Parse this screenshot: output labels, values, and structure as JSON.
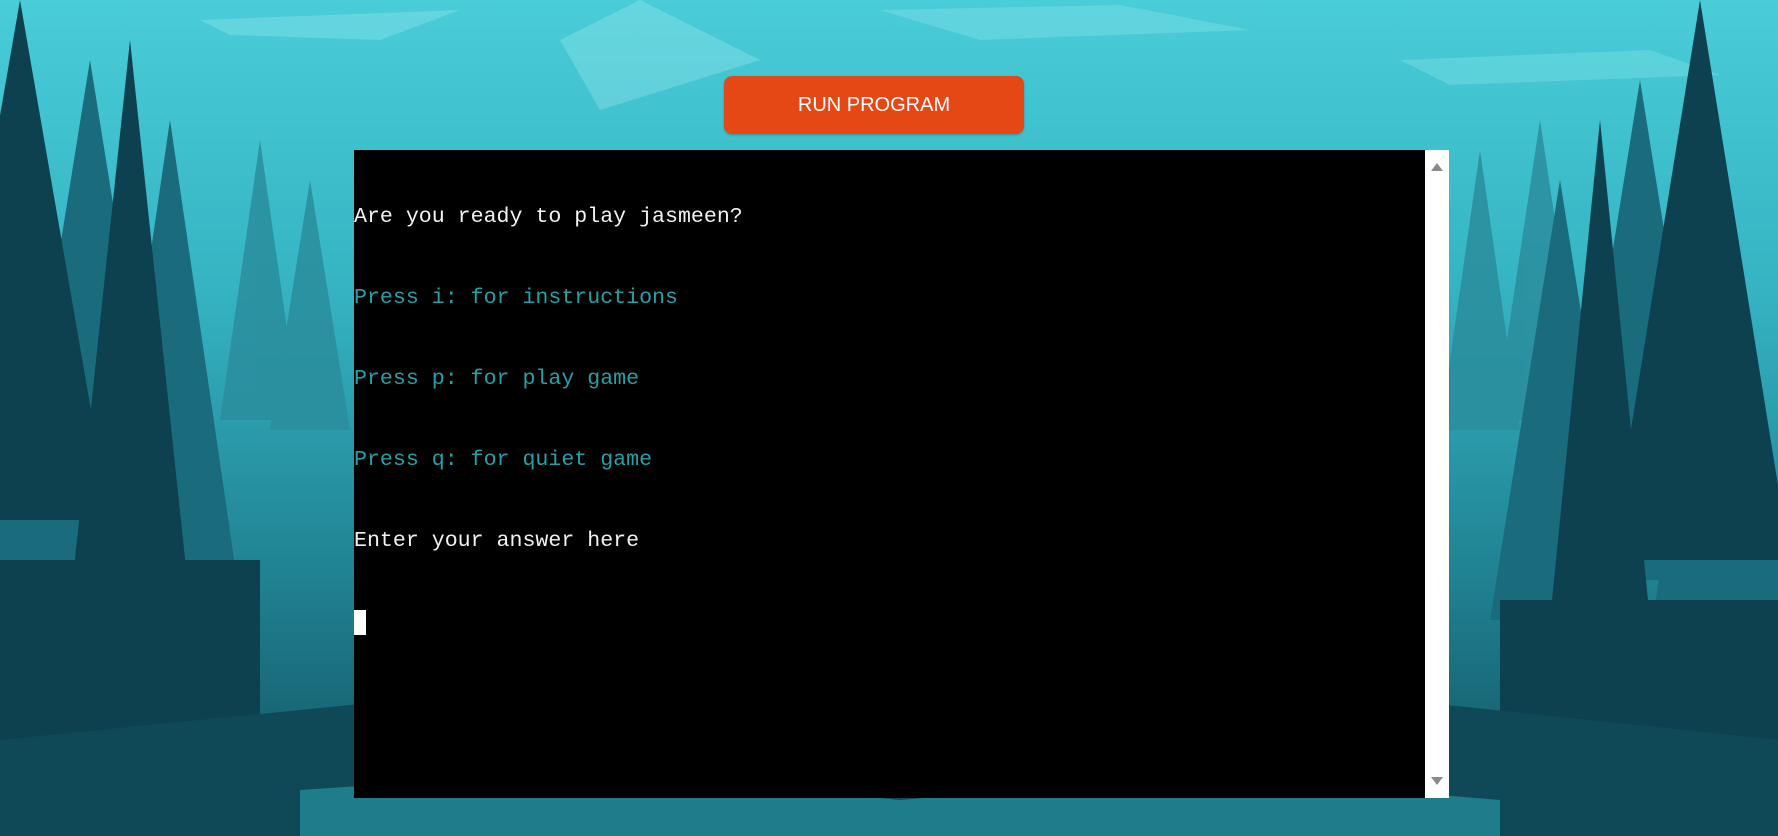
{
  "header": {
    "run_button_label": "RUN PROGRAM"
  },
  "terminal": {
    "lines": [
      {
        "text": "Are you ready to play jasmeen?",
        "color": "#f2f2f2"
      },
      {
        "text": "Press i: for instructions",
        "color": "#26a0a8"
      },
      {
        "text": "Press p: for play game",
        "color": "#26a0a8"
      },
      {
        "text": "Press q: for quiet game",
        "color": "#26a0a8"
      },
      {
        "text": "Enter your answer here",
        "color": "#f2f2f2"
      }
    ]
  },
  "colors": {
    "button": "#e64815",
    "terminal_bg": "#000000",
    "prompt_text": "#f2f2f2",
    "option_text": "#26a0a8"
  },
  "icons": {
    "scroll_up": "scroll-up-arrow-icon",
    "scroll_down": "scroll-down-arrow-icon"
  }
}
